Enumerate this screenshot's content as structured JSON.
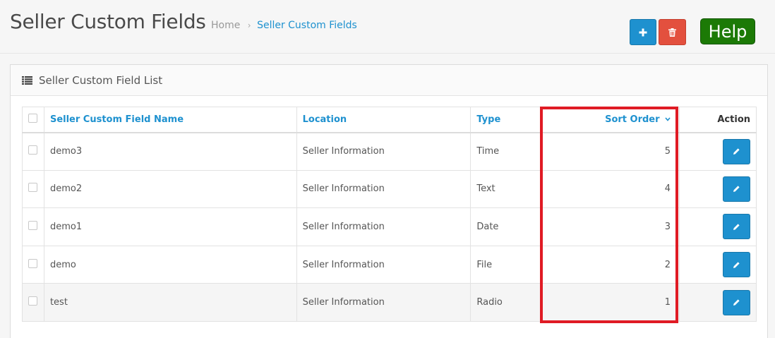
{
  "header": {
    "title": "Seller Custom Fields",
    "breadcrumb": {
      "home": "Home",
      "separator": "›",
      "current": "Seller Custom Fields"
    },
    "buttons": {
      "add_icon": "plus-icon",
      "delete_icon": "trash-icon",
      "help_label": "Help"
    }
  },
  "panel": {
    "title": "Seller Custom Field List",
    "title_icon": "list-icon"
  },
  "table": {
    "columns": {
      "name": "Seller Custom Field Name",
      "location": "Location",
      "type": "Type",
      "sort_order": "Sort Order",
      "action": "Action"
    },
    "rows": [
      {
        "name": "demo3",
        "location": "Seller Information",
        "type": "Time",
        "sort_order": "5"
      },
      {
        "name": "demo2",
        "location": "Seller Information",
        "type": "Text",
        "sort_order": "4"
      },
      {
        "name": "demo1",
        "location": "Seller Information",
        "type": "Date",
        "sort_order": "3"
      },
      {
        "name": "demo",
        "location": "Seller Information",
        "type": "File",
        "sort_order": "2"
      },
      {
        "name": "test",
        "location": "Seller Information",
        "type": "Radio",
        "sort_order": "1"
      }
    ]
  },
  "colors": {
    "primary": "#1e91cf",
    "danger": "#e3503e",
    "help": "#1c7a06",
    "highlight": "#e01b24"
  }
}
